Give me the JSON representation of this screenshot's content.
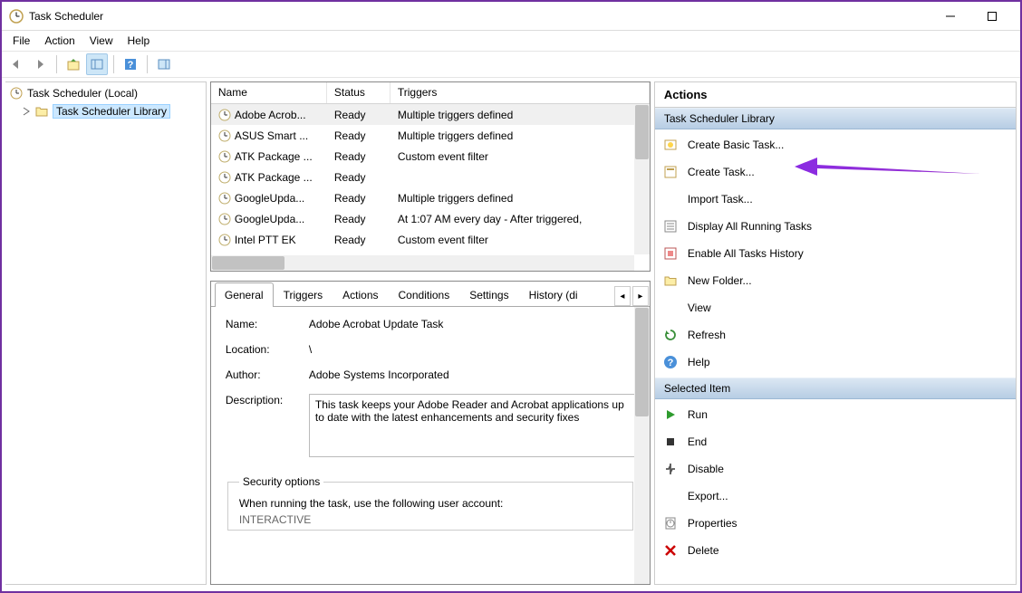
{
  "window": {
    "title": "Task Scheduler"
  },
  "menubar": [
    "File",
    "Action",
    "View",
    "Help"
  ],
  "tree": {
    "root": "Task Scheduler (Local)",
    "child": "Task Scheduler Library"
  },
  "grid": {
    "columns": {
      "name": "Name",
      "status": "Status",
      "triggers": "Triggers"
    },
    "rows": [
      {
        "name": "Adobe Acrob...",
        "status": "Ready",
        "triggers": "Multiple triggers defined",
        "selected": true
      },
      {
        "name": "ASUS Smart ...",
        "status": "Ready",
        "triggers": "Multiple triggers defined"
      },
      {
        "name": "ATK Package ...",
        "status": "Ready",
        "triggers": "Custom event filter"
      },
      {
        "name": "ATK Package ...",
        "status": "Ready",
        "triggers": ""
      },
      {
        "name": "GoogleUpda...",
        "status": "Ready",
        "triggers": "Multiple triggers defined"
      },
      {
        "name": "GoogleUpda...",
        "status": "Ready",
        "triggers": "At 1:07 AM every day - After triggered,"
      },
      {
        "name": "Intel PTT EK",
        "status": "Ready",
        "triggers": "Custom event filter"
      }
    ]
  },
  "tabs": [
    "General",
    "Triggers",
    "Actions",
    "Conditions",
    "Settings",
    "History (di"
  ],
  "active_tab": 0,
  "details": {
    "name_label": "Name:",
    "name_value": "Adobe Acrobat Update Task",
    "location_label": "Location:",
    "location_value": "\\",
    "author_label": "Author:",
    "author_value": "Adobe Systems Incorporated",
    "description_label": "Description:",
    "description_value": "This task keeps your Adobe Reader and Acrobat applications up to date with the latest enhancements and security fixes",
    "security_legend": "Security options",
    "security_line1": "When running the task, use the following user account:",
    "security_line2": "INTERACTIVE"
  },
  "actions": {
    "title": "Actions",
    "section1": "Task Scheduler Library",
    "lib": [
      {
        "id": "create-basic",
        "label": "Create Basic Task...",
        "icon": "wizard-icon"
      },
      {
        "id": "create-task",
        "label": "Create Task...",
        "icon": "task-icon"
      },
      {
        "id": "import-task",
        "label": "Import Task...",
        "icon": "blank-icon"
      },
      {
        "id": "display-running",
        "label": "Display All Running Tasks",
        "icon": "list-icon"
      },
      {
        "id": "enable-history",
        "label": "Enable All Tasks History",
        "icon": "history-icon"
      },
      {
        "id": "new-folder",
        "label": "New Folder...",
        "icon": "folder-icon"
      },
      {
        "id": "view",
        "label": "View",
        "icon": "blank-icon"
      },
      {
        "id": "refresh",
        "label": "Refresh",
        "icon": "refresh-icon"
      },
      {
        "id": "help",
        "label": "Help",
        "icon": "help-icon"
      }
    ],
    "section2": "Selected Item",
    "sel": [
      {
        "id": "run",
        "label": "Run",
        "icon": "play-icon",
        "color": "#2e9b2e"
      },
      {
        "id": "end",
        "label": "End",
        "icon": "stop-icon",
        "color": "#333"
      },
      {
        "id": "disable",
        "label": "Disable",
        "icon": "disable-icon",
        "color": "#555"
      },
      {
        "id": "export",
        "label": "Export...",
        "icon": "blank-icon"
      },
      {
        "id": "properties",
        "label": "Properties",
        "icon": "properties-icon"
      },
      {
        "id": "delete",
        "label": "Delete",
        "icon": "delete-icon",
        "color": "#c00"
      }
    ]
  }
}
